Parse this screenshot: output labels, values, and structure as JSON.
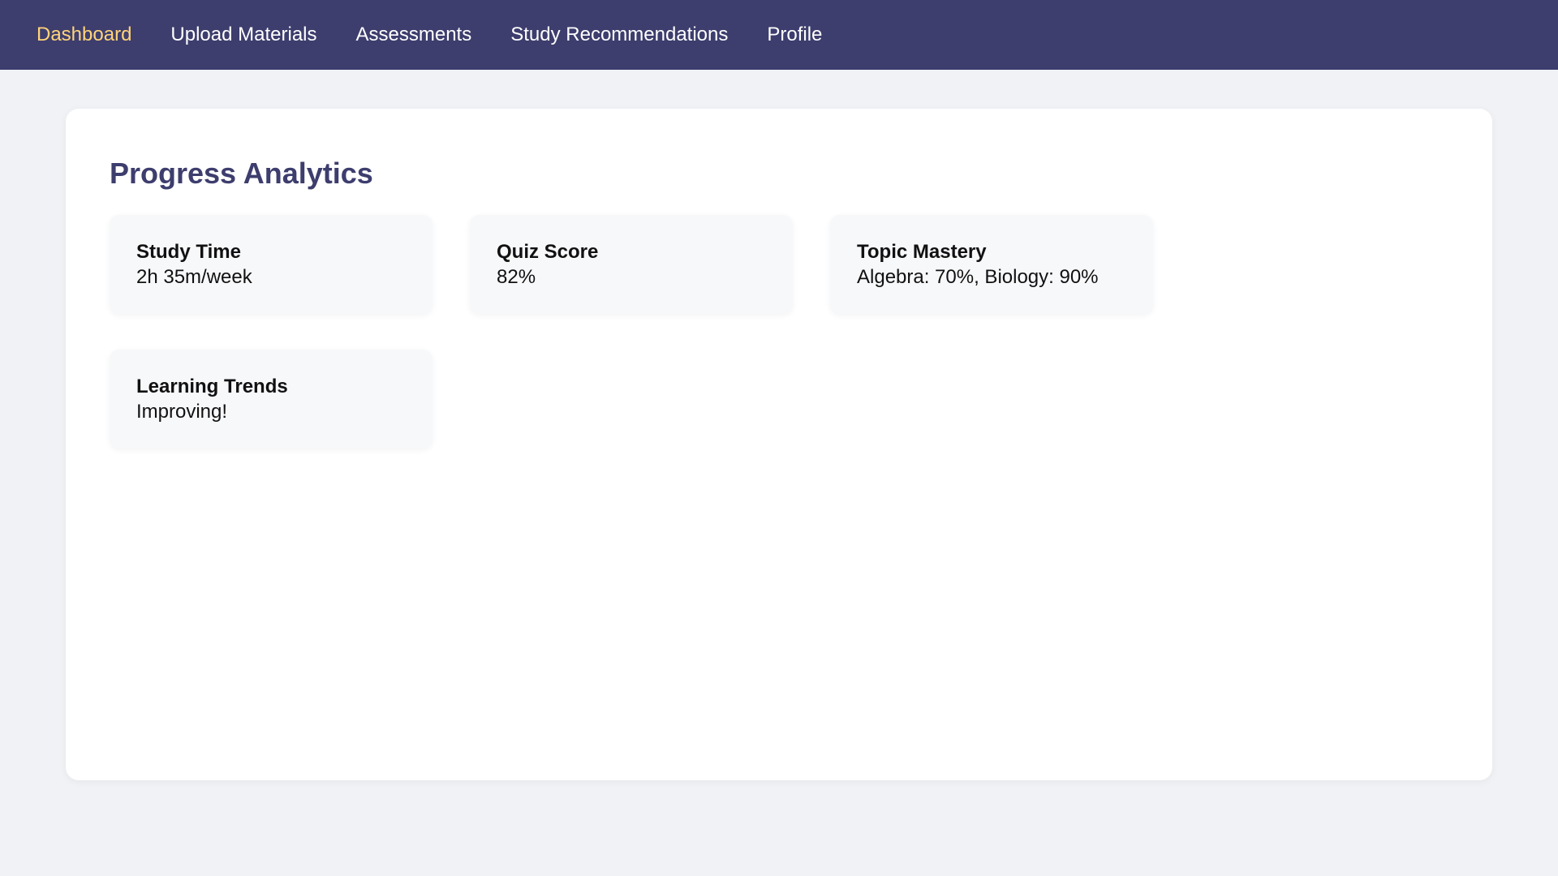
{
  "nav": {
    "items": [
      {
        "label": "Dashboard",
        "active": true
      },
      {
        "label": "Upload Materials",
        "active": false
      },
      {
        "label": "Assessments",
        "active": false
      },
      {
        "label": "Study Recommendations",
        "active": false
      },
      {
        "label": "Profile",
        "active": false
      }
    ]
  },
  "main": {
    "title": "Progress Analytics",
    "cards": [
      {
        "label": "Study Time",
        "value": "2h 35m/week"
      },
      {
        "label": "Quiz Score",
        "value": "82%"
      },
      {
        "label": "Topic Mastery",
        "value": "Algebra: 70%, Biology: 90%"
      },
      {
        "label": "Learning Trends",
        "value": "Improving!"
      }
    ]
  },
  "colors": {
    "nav_background": "#3d3d6e",
    "nav_active": "#ffd479",
    "title": "#3d3d6e",
    "page_background": "#f0f2f5"
  }
}
